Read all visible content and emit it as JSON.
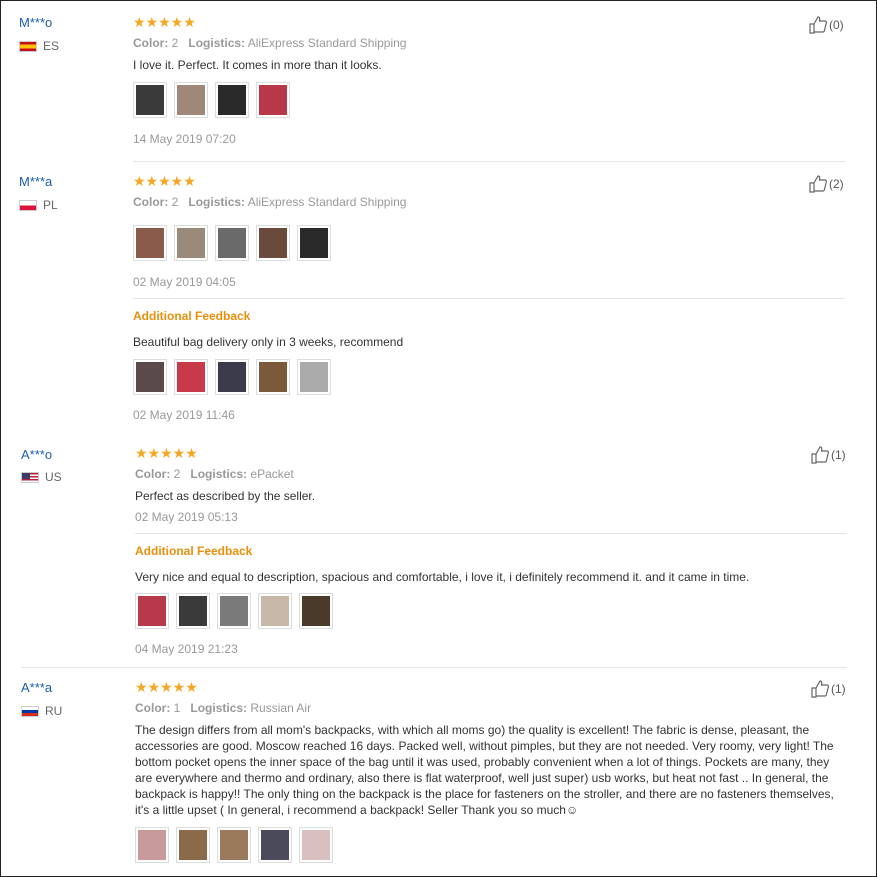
{
  "reviews": [
    {
      "user": "M***o",
      "country": "ES",
      "flag": "es",
      "stars": "★★★★★",
      "color_label": "Color:",
      "color": "2",
      "logistics_label": "Logistics:",
      "logistics": "AliExpress Standard Shipping",
      "text": "I love it. Perfect. It comes in more than it looks.",
      "date": "14 May 2019 07:20",
      "helpful": "(0)",
      "photo_colors": [
        "#3a3a3a",
        "#a08878",
        "#2a2a2a",
        "#b8384a"
      ]
    },
    {
      "user": "M***a",
      "country": "PL",
      "flag": "pl",
      "stars": "★★★★★",
      "color_label": "Color:",
      "color": "2",
      "logistics_label": "Logistics:",
      "logistics": "AliExpress Standard Shipping",
      "text": "",
      "date": "02 May 2019 04:05",
      "helpful": "(2)",
      "photo_colors": [
        "#8a5a4a",
        "#9a8a7a",
        "#6a6a6a",
        "#6a4a3a",
        "#2a2a2a"
      ],
      "additional": {
        "label": "Additional Feedback",
        "text": "Beautiful bag delivery only in 3 weeks, recommend",
        "date": "02 May 2019 11:46",
        "photo_colors": [
          "#5a4a4a",
          "#c83a4a",
          "#3a3a4a",
          "#7a5a3a",
          "#aaaaaa"
        ]
      }
    },
    {
      "user": "A***o",
      "country": "US",
      "flag": "us",
      "stars": "★★★★★",
      "color_label": "Color:",
      "color": "2",
      "logistics_label": "Logistics:",
      "logistics": "ePacket",
      "text": "Perfect as described by the seller.",
      "date": "02 May 2019 05:13",
      "helpful": "(1)",
      "photo_colors": [],
      "additional": {
        "label": "Additional Feedback",
        "text": "Very nice and equal to description, spacious and comfortable, i love it, i definitely recommend it. and it came in time.",
        "date": "04 May 2019 21:23",
        "photo_colors": [
          "#b83a4a",
          "#3a3a3a",
          "#7a7a7a",
          "#c8b8a8",
          "#4a3a2a"
        ]
      }
    },
    {
      "user": "A***a",
      "country": "RU",
      "flag": "ru",
      "stars": "★★★★★",
      "color_label": "Color:",
      "color": "1",
      "logistics_label": "Logistics:",
      "logistics": "Russian Air",
      "text": "The design differs from all mom's backpacks, with which all moms go) the quality is excellent! The fabric is dense, pleasant, the accessories are good. Moscow reached 16 days. Packed well, without pimples, but they are not needed. Very roomy, very light! The bottom pocket opens the inner space of the bag until it was used, probably convenient when a lot of things. Pockets are many, they are everywhere and thermo and ordinary, also there is flat waterproof, well just super) usb works, but heat not fast .. In general, the backpack is happy!! The only thing on the backpack is the place for fasteners on the stroller, and there are no fasteners themselves, it's a little upset ( In general, i recommend a backpack! Seller Thank you so much☺",
      "date": "",
      "helpful": "(1)",
      "photo_colors": [
        "#c89a9a",
        "#8a6a4a",
        "#9a7a5a",
        "#4a4a5a",
        "#d8c0c0"
      ]
    }
  ]
}
